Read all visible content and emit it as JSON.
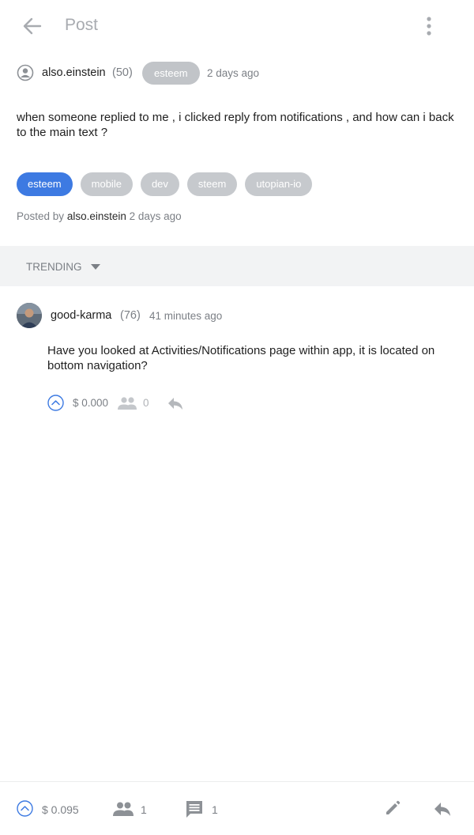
{
  "header": {
    "title": "Post"
  },
  "post": {
    "author": "also.einstein",
    "reputation": "(50)",
    "category": "esteem",
    "time": "2 days ago",
    "body": "when someone replied to me , i clicked reply from notifications , and how can i back to the main text ?",
    "tags": [
      "esteem",
      "mobile",
      "dev",
      "steem",
      "utopian-io"
    ],
    "posted_by_label": "Posted by",
    "posted_by_author": "also.einstein",
    "posted_by_time": "2 days ago"
  },
  "sort": {
    "label": "TRENDING"
  },
  "comment": {
    "author": "good-karma",
    "reputation": "(76)",
    "time": "41 minutes ago",
    "body": "Have you looked at Activities/Notifications page within app, it is located on bottom navigation?",
    "payout": "$ 0.000",
    "voters": "0"
  },
  "bottom_bar": {
    "payout": "$ 0.095",
    "voters": "1",
    "comments": "1"
  },
  "colors": {
    "accent": "#3d7ae2",
    "tag_grey": "#c6c9cd",
    "icon_grey": "#9ea2a7"
  },
  "icons": {
    "back": "arrow-left",
    "more": "vertical-dots",
    "upvote": "chevron-up-circle",
    "voters": "people",
    "comments": "comment",
    "edit": "pencil",
    "reply": "reply-arrow"
  }
}
